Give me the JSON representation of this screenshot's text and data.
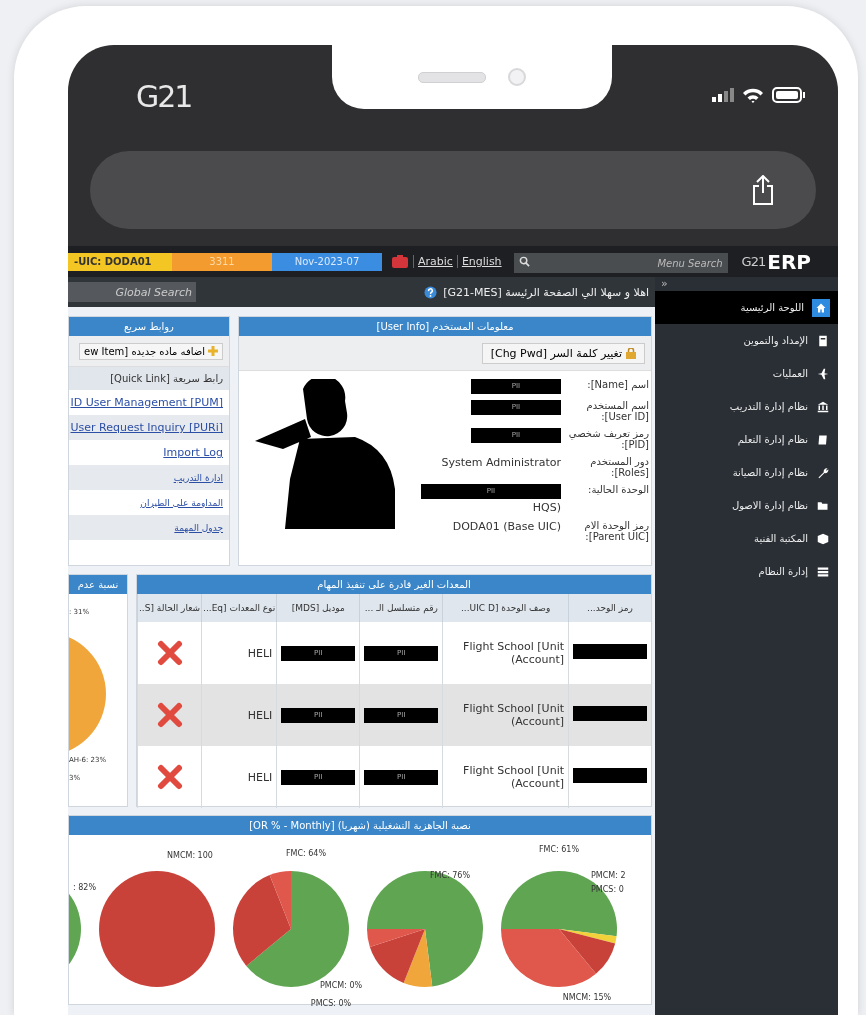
{
  "phone": {
    "logo": "G21"
  },
  "topbar": {
    "badges": [
      {
        "text": "Nov-2023-07",
        "color": "#3a8de0"
      },
      {
        "text": "3311",
        "color": "#f39b2e"
      },
      {
        "text": "-UIC: DODA01",
        "color": "#f3c623"
      }
    ],
    "languages": [
      "English",
      "Arabic"
    ],
    "menu_search": {
      "placeholder": "Menu Search"
    },
    "logo": {
      "mark": "G21",
      "text": "ERP"
    }
  },
  "header": {
    "global_search": {
      "placeholder": "Global Search"
    },
    "welcome": "اهلا و سهلا الي الصفحة الرئيسة [G21-MES]"
  },
  "sidebar": {
    "toggle": "»",
    "items": [
      {
        "label": "اللوحة الرئيسية",
        "selected": true
      },
      {
        "label": "الإمداد والتموين",
        "selected": false
      },
      {
        "label": "العمليات",
        "selected": false
      },
      {
        "label": "نظام إدارة التدريب",
        "selected": false
      },
      {
        "label": "نظام إدارة التعلم",
        "selected": false
      },
      {
        "label": "نظام إدارة الصيانة",
        "selected": false
      },
      {
        "label": "نظام إدارة الاصول",
        "selected": false
      },
      {
        "label": "المكتبة الفنية",
        "selected": false
      },
      {
        "label": "إدارة النظام",
        "selected": false
      }
    ]
  },
  "quick_links": {
    "title": "روابط سريع",
    "new_item": "ew Item] اضافه ماده جديده",
    "section": "رابط سريعة [Quick Link]",
    "links": [
      {
        "label": "ID User Management [PUM]",
        "kind": "latin"
      },
      {
        "label": "User Request Inquiry [PURi]",
        "kind": "latin"
      },
      {
        "label": "Import Log",
        "kind": "latin"
      },
      {
        "label": "ادارة التدريب",
        "kind": "arabic"
      },
      {
        "label": "المداومة على الطيران",
        "kind": "arabic"
      },
      {
        "label": "جدول المهمة",
        "kind": "arabic"
      }
    ]
  },
  "user_info": {
    "title": "معلومات المستخدم [User Info]",
    "change_password": "تغيير كلمة السر [Chg Pwd]",
    "fields": [
      {
        "label": "اسم [Name]:",
        "value": [
          {
            "kind": "redacted",
            "text": "PII"
          }
        ]
      },
      {
        "label": "اسم المستخدم [User ID]:",
        "value": [
          {
            "kind": "redacted",
            "text": "PII"
          }
        ]
      },
      {
        "label": "رمز تعريف شخصي [PID]:",
        "value": [
          {
            "kind": "redacted",
            "text": "PII"
          }
        ]
      },
      {
        "label": "دور المستخدم [Roles]:",
        "value": [
          {
            "kind": "text",
            "text": "System Administrator"
          }
        ]
      },
      {
        "label": "الوحدة الحالية:",
        "value": [
          {
            "kind": "redacted",
            "text": "PII"
          },
          {
            "kind": "text",
            "text": "HQS)"
          }
        ]
      },
      {
        "label": "رمز الوحدة الام [Parent UIC]:",
        "value": [
          {
            "kind": "text",
            "text": "DODA01 (Base UIC)"
          }
        ]
      }
    ]
  },
  "side_chart": {
    "title": "نسبة عدم",
    "labels": [
      ": 31%",
      "AH-6: 23%",
      "3%"
    ]
  },
  "equipment": {
    "title": "المعدات الغير قادرة على تنفيذ المهام",
    "columns": [
      "رمز الوحد...",
      "وصف الوحدة [UIC D...",
      "رقم متسلسل الـ ...",
      "موديل [MDS]",
      "نوع المعدات [Eq...",
      "شعار الحالة [S.."
    ],
    "rows": [
      {
        "cells": [
          {
            "kind": "redacted"
          },
          {
            "kind": "text",
            "text": "Flight School [Unit Account])"
          },
          {
            "kind": "redacted",
            "text": "PII"
          },
          {
            "kind": "redacted",
            "text": "PII"
          },
          {
            "kind": "text",
            "text": "HELI"
          },
          {
            "kind": "status",
            "ok": false
          }
        ]
      },
      {
        "cells": [
          {
            "kind": "redacted"
          },
          {
            "kind": "text",
            "text": "Flight School [Unit Account])"
          },
          {
            "kind": "redacted",
            "text": "PII"
          },
          {
            "kind": "redacted",
            "text": "PII"
          },
          {
            "kind": "text",
            "text": "HELI"
          },
          {
            "kind": "status",
            "ok": false
          }
        ]
      },
      {
        "cells": [
          {
            "kind": "redacted"
          },
          {
            "kind": "text",
            "text": "Flight School [Unit Account])"
          },
          {
            "kind": "redacted",
            "text": "PII"
          },
          {
            "kind": "redacted",
            "text": "PII"
          },
          {
            "kind": "text",
            "text": "HELI"
          },
          {
            "kind": "status",
            "ok": false
          }
        ]
      }
    ]
  },
  "readiness": {
    "title": "نصبة الجاهزية التشغيلية (شهريا) [OR % - Monthly]",
    "pies": [
      {
        "labels": [
          ": 82%"
        ]
      },
      {
        "labels": [
          "NMCM: 100"
        ]
      },
      {
        "labels": [
          "FMC: 64%",
          "PMCM: 0%",
          "PMCS: 0%"
        ]
      },
      {
        "labels": [
          "FMC: 76%"
        ]
      },
      {
        "labels": [
          "FMC: 61%",
          "PMCM: 2",
          "PMCS: 0",
          "NMCM: 15%"
        ]
      }
    ]
  }
}
